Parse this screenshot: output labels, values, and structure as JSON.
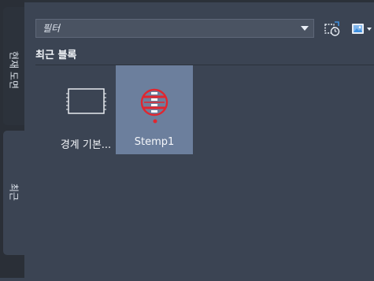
{
  "side_tabs": [
    {
      "label": "현재 도면"
    },
    {
      "label": "최근"
    }
  ],
  "filter": {
    "placeholder": "필터",
    "value": ""
  },
  "section": {
    "title": "최근 블록"
  },
  "blocks": [
    {
      "label": "경계 기본...",
      "icon": "rectangle-block-icon",
      "selected": false
    },
    {
      "label": "Stemp1",
      "icon": "red-stamp-icon",
      "selected": true
    }
  ],
  "colors": {
    "panel_bg": "#3b4453",
    "selected_bg": "#6c7f9d",
    "accent_blue": "#3e8fde",
    "stamp_red": "#e1262f"
  }
}
